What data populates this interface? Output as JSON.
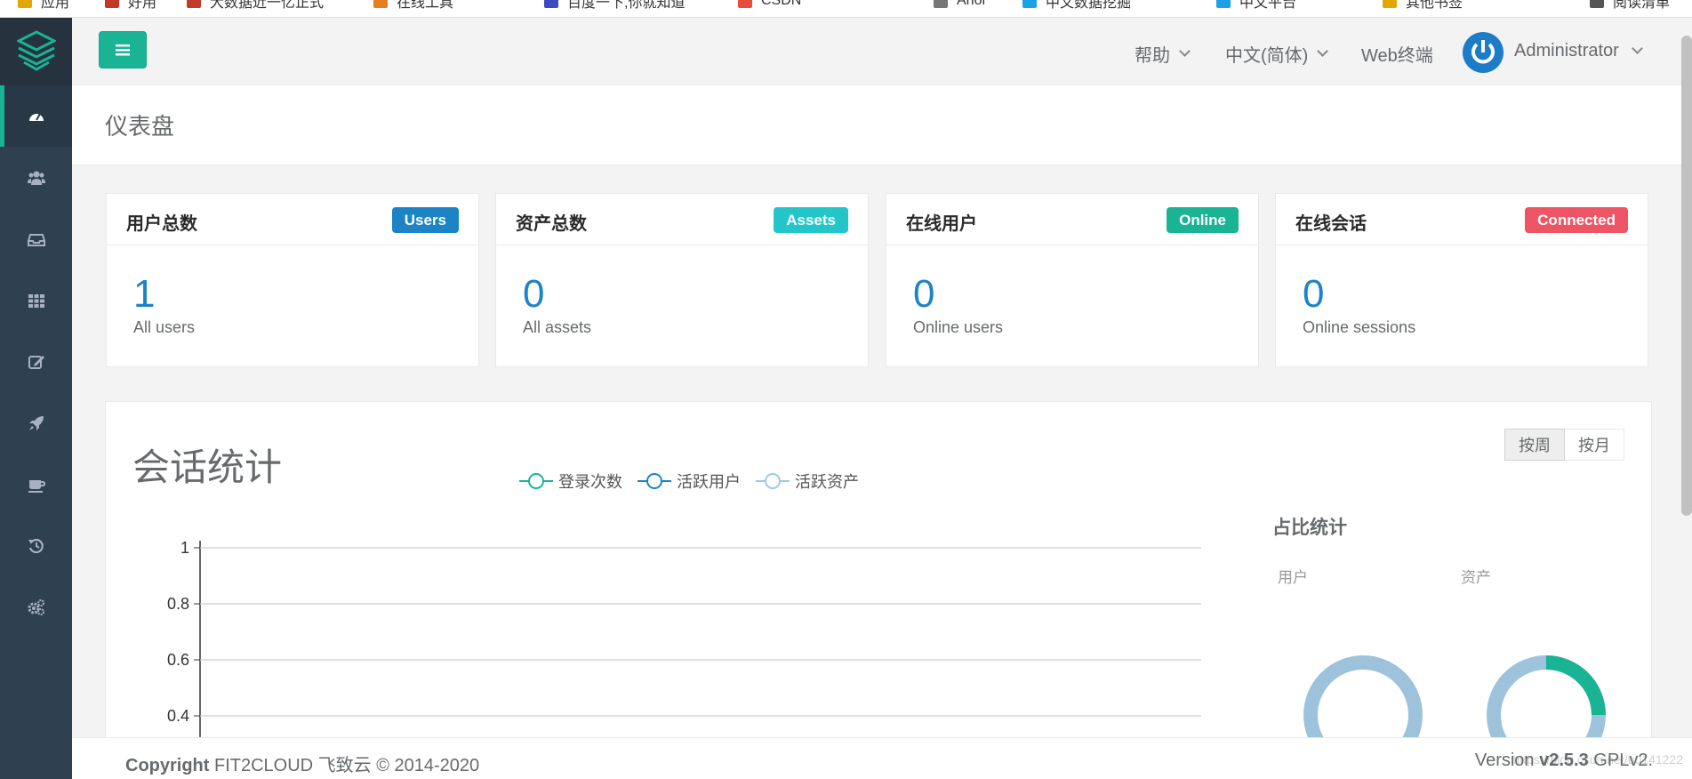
{
  "bookmarks": [
    {
      "label": "应用",
      "color": "#e0a800"
    },
    {
      "label": "好用",
      "color": "#c0392b"
    },
    {
      "label": "大数据近一亿正式",
      "color": "#c0392b"
    },
    {
      "label": "在线工具",
      "color": "#e67e22"
    },
    {
      "label": "百度一下,你就知道",
      "color": "#3b4cc0"
    },
    {
      "label": "CSDN",
      "color": "#e74c3c"
    },
    {
      "label": "Ahoi",
      "color": "#777777"
    },
    {
      "label": "中文数据挖掘",
      "color": "#1ca1e6"
    },
    {
      "label": "中文平台",
      "color": "#1ca1e6"
    },
    {
      "label": "其他书签",
      "color": "#e0a800"
    },
    {
      "label": "阅读清单",
      "color": "#555555"
    }
  ],
  "sidebar": {
    "items": [
      {
        "name": "dashboard",
        "icon": "dashboard-icon",
        "active": true
      },
      {
        "name": "users",
        "icon": "users-icon",
        "active": false
      },
      {
        "name": "assets",
        "icon": "inbox-icon",
        "active": false
      },
      {
        "name": "applications",
        "icon": "grid-icon",
        "active": false
      },
      {
        "name": "perms",
        "icon": "edit-icon",
        "active": false
      },
      {
        "name": "sessions",
        "icon": "rocket-icon",
        "active": false
      },
      {
        "name": "tickets",
        "icon": "coffee-icon",
        "active": false
      },
      {
        "name": "audits",
        "icon": "history-icon",
        "active": false
      },
      {
        "name": "settings",
        "icon": "gears-icon",
        "active": false
      }
    ]
  },
  "topbar": {
    "help": "帮助",
    "language": "中文(简体)",
    "web_terminal": "Web终端",
    "user": "Administrator"
  },
  "page": {
    "title": "仪表盘"
  },
  "cards": [
    {
      "title": "用户总数",
      "badge": "Users",
      "badge_color": "#1c84c6",
      "value": "1",
      "sub": "All users"
    },
    {
      "title": "资产总数",
      "badge": "Assets",
      "badge_color": "#23c6c8",
      "value": "0",
      "sub": "All assets"
    },
    {
      "title": "在线用户",
      "badge": "Online",
      "badge_color": "#1ab394",
      "value": "0",
      "sub": "Online users"
    },
    {
      "title": "在线会话",
      "badge": "Connected",
      "badge_color": "#ed5565",
      "value": "0",
      "sub": "Online sessions"
    }
  ],
  "session_stats": {
    "title": "会话统计",
    "buttons": {
      "week": "按周",
      "month": "按月"
    },
    "ratio_title": "占比统计",
    "ratio_labels": {
      "users": "用户",
      "assets": "资产"
    }
  },
  "chart_data": {
    "type": "line",
    "series": [
      {
        "name": "登录次数",
        "color": "#1ab394",
        "values": []
      },
      {
        "name": "活跃用户",
        "color": "#1c84c6",
        "values": []
      },
      {
        "name": "活跃资产",
        "color": "#9ecae1",
        "values": []
      }
    ],
    "y_ticks": [
      "1",
      "0.8",
      "0.6",
      "0.4"
    ],
    "ylim": [
      0,
      1
    ],
    "grid": true,
    "legend": "top-center"
  },
  "ratio_charts": [
    {
      "label": "用户",
      "fraction_highlight": 0,
      "base_color": "#9dc3dc",
      "highlight_color": "#1ab394"
    },
    {
      "label": "资产",
      "fraction_highlight": 0.25,
      "base_color": "#9dc3dc",
      "highlight_color": "#1ab394"
    }
  ],
  "footer": {
    "copyright_label": "Copyright",
    "copyright_text": "FIT2CLOUD 飞致云 © 2014-2020",
    "version_label": "Version",
    "version": "v2.5.3",
    "license": "GPLv2.",
    "watermark": "https://blog.csdn.net/u0141222"
  }
}
